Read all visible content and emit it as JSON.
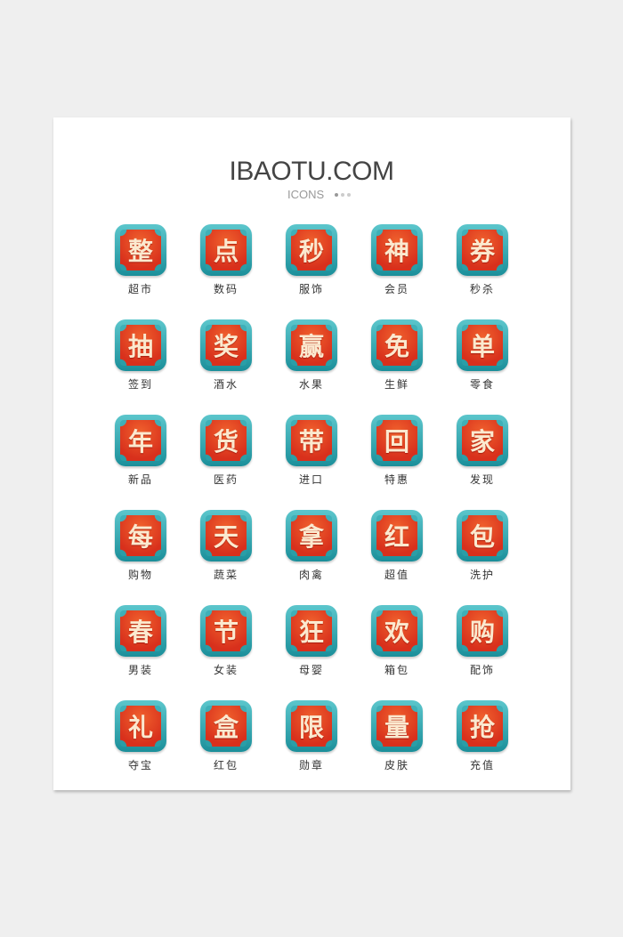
{
  "header": {
    "title": "IBAOTU.COM",
    "subtitle": "ICONS"
  },
  "colors": {
    "teal": "#2a9ea7",
    "red": "#d8301c",
    "character": "#fbe9cf"
  },
  "icons": [
    {
      "char": "整",
      "label": "超市"
    },
    {
      "char": "点",
      "label": "数码"
    },
    {
      "char": "秒",
      "label": "服饰"
    },
    {
      "char": "神",
      "label": "会员"
    },
    {
      "char": "券",
      "label": "秒杀"
    },
    {
      "char": "抽",
      "label": "签到"
    },
    {
      "char": "奖",
      "label": "酒水"
    },
    {
      "char": "赢",
      "label": "水果"
    },
    {
      "char": "免",
      "label": "生鲜"
    },
    {
      "char": "单",
      "label": "零食"
    },
    {
      "char": "年",
      "label": "新品"
    },
    {
      "char": "货",
      "label": "医药"
    },
    {
      "char": "带",
      "label": "进口"
    },
    {
      "char": "回",
      "label": "特惠"
    },
    {
      "char": "家",
      "label": "发现"
    },
    {
      "char": "每",
      "label": "购物"
    },
    {
      "char": "天",
      "label": "蔬菜"
    },
    {
      "char": "拿",
      "label": "肉禽"
    },
    {
      "char": "红",
      "label": "超值"
    },
    {
      "char": "包",
      "label": "洗护"
    },
    {
      "char": "春",
      "label": "男装"
    },
    {
      "char": "节",
      "label": "女装"
    },
    {
      "char": "狂",
      "label": "母婴"
    },
    {
      "char": "欢",
      "label": "箱包"
    },
    {
      "char": "购",
      "label": "配饰"
    },
    {
      "char": "礼",
      "label": "夺宝"
    },
    {
      "char": "盒",
      "label": "红包"
    },
    {
      "char": "限",
      "label": "勋章"
    },
    {
      "char": "量",
      "label": "皮肤"
    },
    {
      "char": "抢",
      "label": "充值"
    }
  ]
}
